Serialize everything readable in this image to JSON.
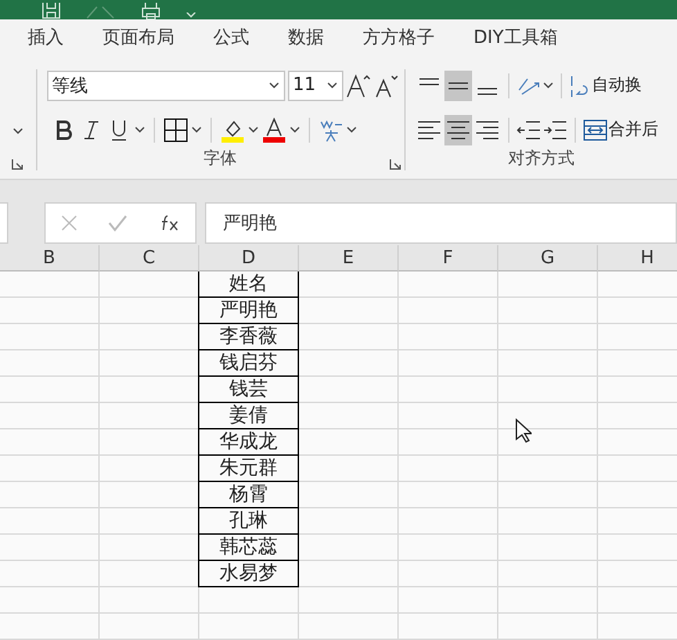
{
  "tabs": [
    {
      "label": "插入",
      "selected": false
    },
    {
      "label": "页面布局",
      "selected": false
    },
    {
      "label": "公式",
      "selected": false
    },
    {
      "label": "数据",
      "selected": false
    },
    {
      "label": "方方格子",
      "selected": false
    },
    {
      "label": "DIY工具箱",
      "selected": false
    }
  ],
  "font_group": {
    "font_name": "等线",
    "font_size": "11",
    "label": "字体"
  },
  "align_group": {
    "label": "对齐方式",
    "vertical": [
      {
        "kind": "top",
        "selected": false
      },
      {
        "kind": "middle",
        "selected": true
      },
      {
        "kind": "bottom",
        "selected": false
      }
    ],
    "horizontal": [
      {
        "kind": "left",
        "selected": false
      },
      {
        "kind": "center",
        "selected": true
      },
      {
        "kind": "right",
        "selected": false
      }
    ],
    "wrap_label": "自动换",
    "merge_label": "合并后"
  },
  "formula_bar": {
    "value": "严明艳"
  },
  "columns": [
    "B",
    "C",
    "D",
    "E",
    "F",
    "G",
    "H"
  ],
  "rows": [
    [
      "",
      "",
      "姓名",
      "",
      "",
      "",
      ""
    ],
    [
      "",
      "",
      "严明艳",
      "",
      "",
      "",
      ""
    ],
    [
      "",
      "",
      "李香薇",
      "",
      "",
      "",
      ""
    ],
    [
      "",
      "",
      "钱启芬",
      "",
      "",
      "",
      ""
    ],
    [
      "",
      "",
      "钱芸",
      "",
      "",
      "",
      ""
    ],
    [
      "",
      "",
      "姜倩",
      "",
      "",
      "",
      ""
    ],
    [
      "",
      "",
      "华成龙",
      "",
      "",
      "",
      ""
    ],
    [
      "",
      "",
      "朱元群",
      "",
      "",
      "",
      ""
    ],
    [
      "",
      "",
      "杨霄",
      "",
      "",
      "",
      ""
    ],
    [
      "",
      "",
      "孔琳",
      "",
      "",
      "",
      ""
    ],
    [
      "",
      "",
      "韩芯蕊",
      "",
      "",
      "",
      ""
    ],
    [
      "",
      "",
      "水易梦",
      "",
      "",
      "",
      ""
    ]
  ]
}
